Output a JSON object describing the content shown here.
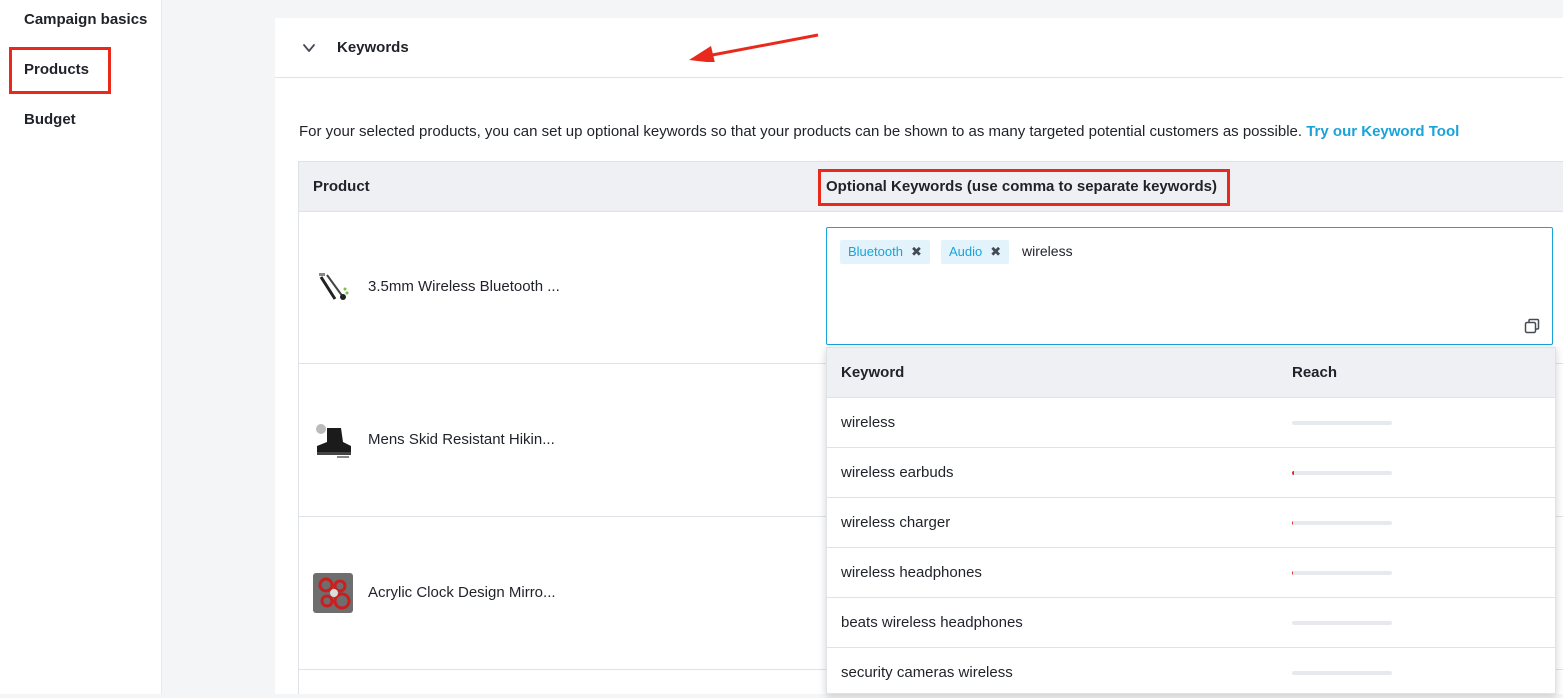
{
  "sidebar": {
    "items": [
      {
        "label": "Campaign basics"
      },
      {
        "label": "Products"
      },
      {
        "label": "Budget"
      }
    ]
  },
  "section": {
    "title": "Keywords",
    "description": "For your selected products, you can set up optional keywords so that your products can be shown to as many targeted potential customers as possible.",
    "link": "Try our Keyword Tool"
  },
  "table": {
    "headers": {
      "product": "Product",
      "keywords": "Optional Keywords (use comma to separate keywords)"
    },
    "rows": [
      {
        "name": "3.5mm Wireless Bluetooth ..."
      },
      {
        "name": "Mens Skid Resistant Hikin..."
      },
      {
        "name": "Acrylic Clock Design Mirro..."
      }
    ]
  },
  "keyword_input": {
    "tags": [
      {
        "label": "Bluetooth"
      },
      {
        "label": "Audio"
      }
    ],
    "typed_value": "wireless"
  },
  "suggestions": {
    "headers": {
      "keyword": "Keyword",
      "reach": "Reach"
    },
    "rows": [
      {
        "keyword": "wireless",
        "reach": 0.0
      },
      {
        "keyword": "wireless earbuds",
        "reach": 0.02
      },
      {
        "keyword": "wireless charger",
        "reach": 0.01
      },
      {
        "keyword": "wireless headphones",
        "reach": 0.01
      },
      {
        "keyword": "beats wireless headphones",
        "reach": 0.0
      },
      {
        "keyword": "security cameras wireless",
        "reach": 0.0
      }
    ]
  },
  "colors": {
    "accent": "#1aa3d9",
    "annotation_red": "#e8291c",
    "tag_bg": "#e3f3fb"
  }
}
